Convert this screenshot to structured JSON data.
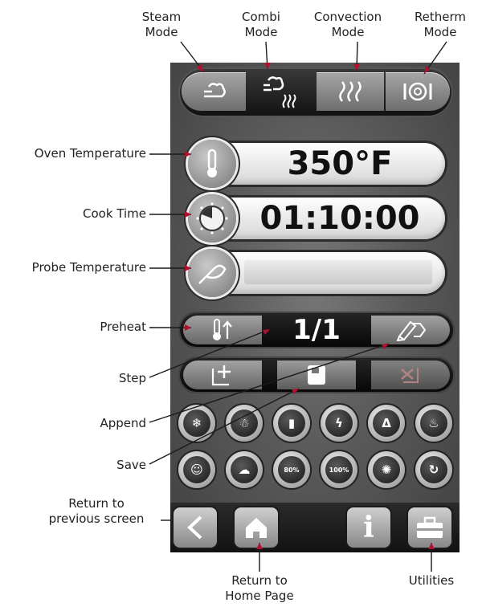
{
  "callouts": {
    "steam_mode": "Steam\nMode",
    "combi_mode": "Combi\nMode",
    "convection_mode": "Convection\nMode",
    "retherm_mode": "Retherm\nMode",
    "oven_temperature": "Oven Temperature",
    "cook_time": "Cook Time",
    "probe_temperature": "Probe Temperature",
    "preheat": "Preheat",
    "step": "Step",
    "append": "Append",
    "save": "Save",
    "return_previous": "Return to\nprevious screen",
    "return_home": "Return to\nHome Page",
    "utilities": "Utilities"
  },
  "display": {
    "oven_temperature": "350°F",
    "cook_time": "01:10:00",
    "probe_temperature": "",
    "step": "1/1"
  },
  "option_labels": {
    "humidity_80": "80%",
    "humidity_100": "100%",
    "info": "i"
  },
  "colors": {
    "leader_line": "#1a1a1a",
    "arrow_accent": "#b01030",
    "screen_background": "#5a5a5a"
  }
}
